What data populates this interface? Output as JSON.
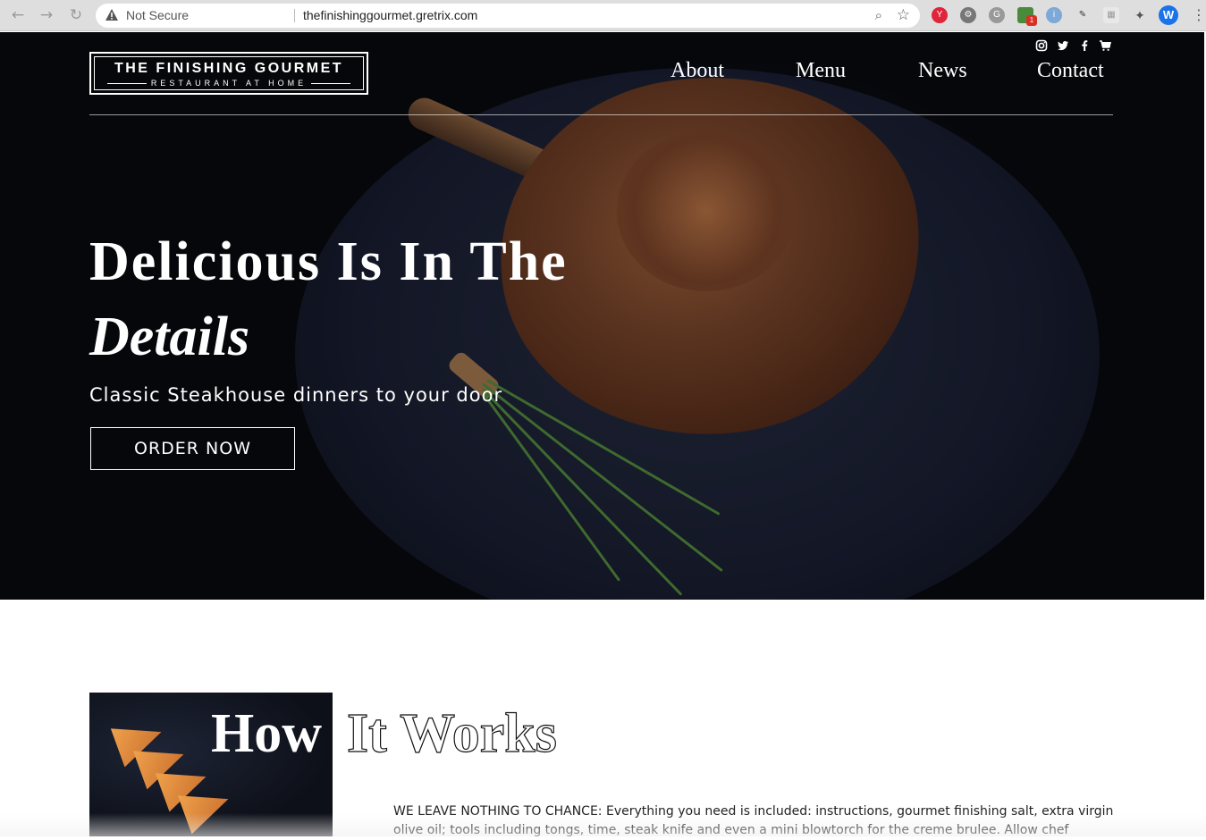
{
  "browser": {
    "security_label": "Not Secure",
    "url": "thefinishinggourmet.gretrix.com",
    "profile_initial": "W",
    "extension_badge": "1"
  },
  "site": {
    "logo_title": "THE FINISHING GOURMET",
    "logo_subtitle": "RESTAURANT AT HOME",
    "nav": [
      "About",
      "Menu",
      "News",
      "Contact"
    ],
    "social_icons": [
      "instagram-icon",
      "twitter-icon",
      "facebook-icon",
      "cart-icon"
    ]
  },
  "hero": {
    "headline_line1": "Delicious Is In The",
    "headline_line2": "Details",
    "subheading": "Classic Steakhouse dinners to your door",
    "cta_label": "ORDER NOW"
  },
  "how_it_works": {
    "title_part1": "How",
    "title_part2": "It Works",
    "lead": "WE LEAVE NOTHING TO CHANCE:",
    "body": " Everything you need is included: instructions, gourmet finishing salt, extra virgin olive oil; tools including tongs, time, steak knife and even a mini blowtorch for the creme brulee. Allow chef"
  },
  "colors": {
    "hero_bg": "#06070b",
    "accent_white": "#ffffff",
    "profile_blue": "#1a73e8"
  }
}
